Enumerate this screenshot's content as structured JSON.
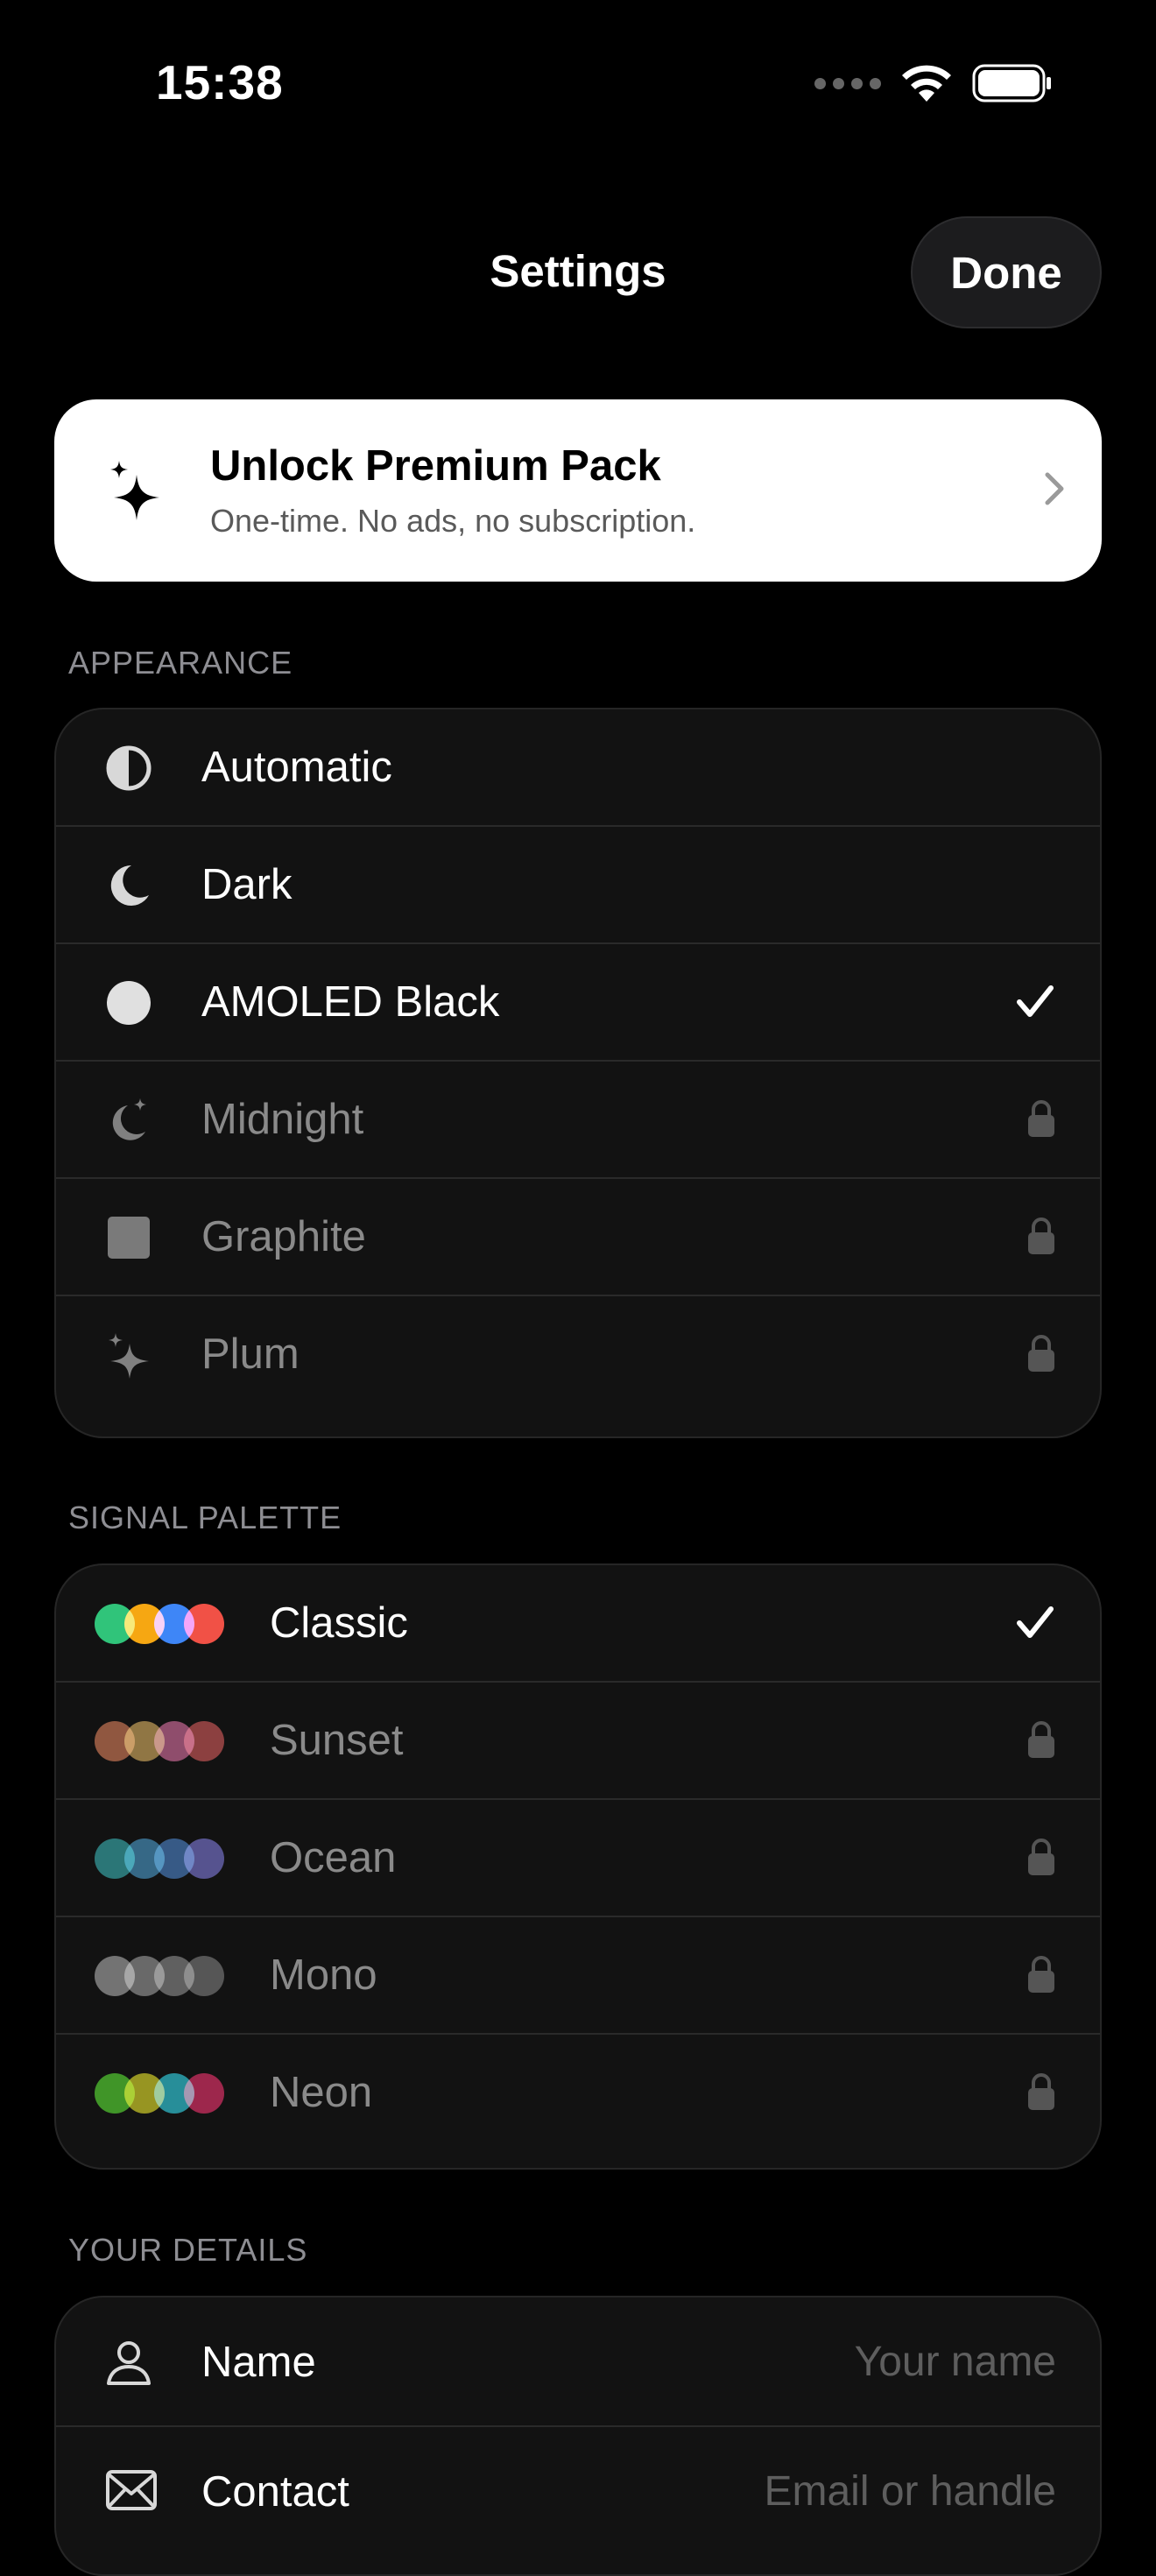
{
  "status": {
    "time": "15:38"
  },
  "nav": {
    "title": "Settings",
    "done_label": "Done"
  },
  "premium": {
    "title": "Unlock Premium Pack",
    "subtitle": "One-time. No ads, no subscription."
  },
  "appearance": {
    "header": "APPEARANCE",
    "items": [
      {
        "label": "Automatic",
        "icon": "half-circle-icon",
        "selected": false,
        "locked": false
      },
      {
        "label": "Dark",
        "icon": "moon-icon",
        "selected": false,
        "locked": false
      },
      {
        "label": "AMOLED Black",
        "icon": "filled-circle-icon",
        "selected": true,
        "locked": false
      },
      {
        "label": "Midnight",
        "icon": "moon-stars-icon",
        "selected": false,
        "locked": true
      },
      {
        "label": "Graphite",
        "icon": "square-icon",
        "selected": false,
        "locked": true
      },
      {
        "label": "Plum",
        "icon": "sparkles-icon",
        "selected": false,
        "locked": true
      }
    ]
  },
  "palette": {
    "header": "SIGNAL PALETTE",
    "items": [
      {
        "label": "Classic",
        "colors": [
          "#20c070",
          "#f5a000",
          "#2f7df6",
          "#f04438"
        ],
        "selected": true,
        "locked": false
      },
      {
        "label": "Sunset",
        "colors": [
          "#a0573a",
          "#a07f3f",
          "#9e4a72",
          "#9a3a3a"
        ],
        "selected": false,
        "locked": true
      },
      {
        "label": "Ocean",
        "colors": [
          "#1f7f80",
          "#2e6d93",
          "#2f5c93",
          "#55529e"
        ],
        "selected": false,
        "locked": true
      },
      {
        "label": "Mono",
        "colors": [
          "#7a7a7a",
          "#6e6e6e",
          "#636363",
          "#555555"
        ],
        "selected": false,
        "locked": true
      },
      {
        "label": "Neon",
        "colors": [
          "#3aa61c",
          "#a8a613",
          "#1b9cab",
          "#b01b48"
        ],
        "selected": false,
        "locked": true
      }
    ]
  },
  "details": {
    "header": "YOUR DETAILS",
    "items": [
      {
        "label": "Name",
        "icon": "person-icon",
        "placeholder": "Your name"
      },
      {
        "label": "Contact",
        "icon": "envelope-icon",
        "placeholder": "Email or handle"
      }
    ]
  },
  "colors": {
    "accent": "#ffffff",
    "background": "#000000",
    "card": "#121212"
  }
}
